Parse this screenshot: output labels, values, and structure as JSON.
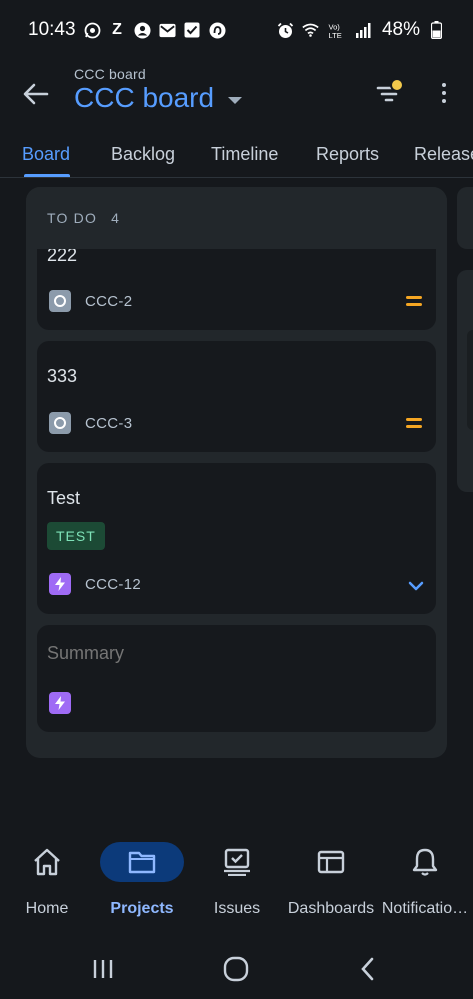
{
  "status_bar": {
    "time": "10:43",
    "battery": "48%",
    "left_icons": [
      "whatsapp-icon",
      "z-app-icon",
      "account-icon",
      "gmail-icon",
      "check-box-icon",
      "app-icon"
    ],
    "right_icons": [
      "alarm-icon",
      "wifi-icon",
      "volte-icon",
      "signal-icon",
      "battery-icon"
    ]
  },
  "app_bar": {
    "subtitle": "CCC board",
    "title": "CCC board"
  },
  "tabs": [
    {
      "label": "Board",
      "active": true
    },
    {
      "label": "Backlog",
      "active": false
    },
    {
      "label": "Timeline",
      "active": false
    },
    {
      "label": "Reports",
      "active": false
    },
    {
      "label": "Releases",
      "active": false
    }
  ],
  "column": {
    "name": "TO DO",
    "count": "4",
    "cards": [
      {
        "title": "222",
        "key": "CCC-2",
        "type": "task-icon",
        "priority": "medium"
      },
      {
        "title": "333",
        "key": "CCC-3",
        "type": "task-icon",
        "priority": "medium"
      },
      {
        "title": "Test",
        "label": "TEST",
        "key": "CCC-12",
        "type": "epic-icon",
        "priority": "low"
      }
    ],
    "new_card": {
      "placeholder": "Summary",
      "type": "epic-icon"
    }
  },
  "bottom_nav": [
    {
      "label": "Home",
      "icon": "home-icon",
      "active": false
    },
    {
      "label": "Projects",
      "icon": "folder-icon",
      "active": true
    },
    {
      "label": "Issues",
      "icon": "issues-icon",
      "active": false
    },
    {
      "label": "Dashboards",
      "icon": "dashboard-icon",
      "active": false
    },
    {
      "label": "Notificatio…",
      "icon": "bell-icon",
      "active": false
    }
  ],
  "colors": {
    "accent": "#579dff",
    "background": "#15181c",
    "column": "#22272b",
    "card": "#16191d",
    "priority_medium": "#f5a623",
    "epic": "#9f6bf5",
    "label_bg": "#1c4a35",
    "label_text": "#7ee2b8"
  }
}
